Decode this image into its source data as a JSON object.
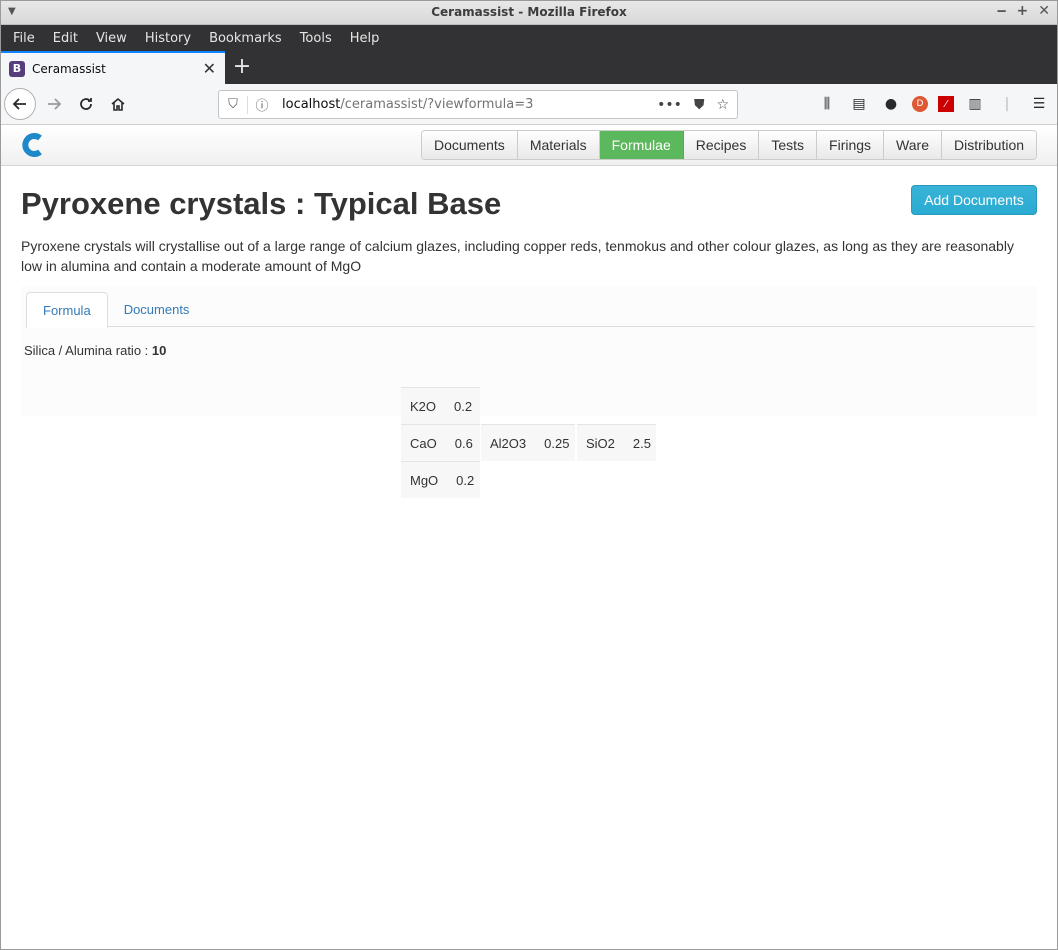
{
  "window": {
    "title": "Ceramassist - Mozilla Firefox"
  },
  "menubar": [
    "File",
    "Edit",
    "View",
    "History",
    "Bookmarks",
    "Tools",
    "Help"
  ],
  "browser_tab": {
    "title": "Ceramassist",
    "favicon_letter": "B"
  },
  "urlbar": {
    "host": "localhost",
    "path": "/ceramassist/?viewformula=3"
  },
  "app_nav": {
    "items": [
      "Documents",
      "Materials",
      "Formulae",
      "Recipes",
      "Tests",
      "Firings",
      "Ware",
      "Distribution"
    ],
    "active": "Formulae",
    "active_color": "#5cb85c"
  },
  "page": {
    "title": "Pyroxene crystals : Typical Base",
    "add_documents_label": "Add Documents",
    "description": "Pyroxene crystals will crystallise out of a large range of calcium glazes, including copper reds, tenmokus and other colour glazes, as long as they are reasonably low in alumina and contain a moderate amount of MgO",
    "tabs": [
      "Formula",
      "Documents"
    ],
    "active_tab": "Formula",
    "ratio_label": "Silica / Alumina ratio : ",
    "ratio_value": "10"
  },
  "formula": {
    "fluxes": [
      {
        "oxide": "K2O",
        "amount": "0.2"
      },
      {
        "oxide": "CaO",
        "amount": "0.6"
      },
      {
        "oxide": "MgO",
        "amount": "0.2"
      }
    ],
    "stabilizer": {
      "oxide": "Al2O3",
      "amount": "0.25"
    },
    "glass_former": {
      "oxide": "SiO2",
      "amount": "2.5"
    }
  }
}
